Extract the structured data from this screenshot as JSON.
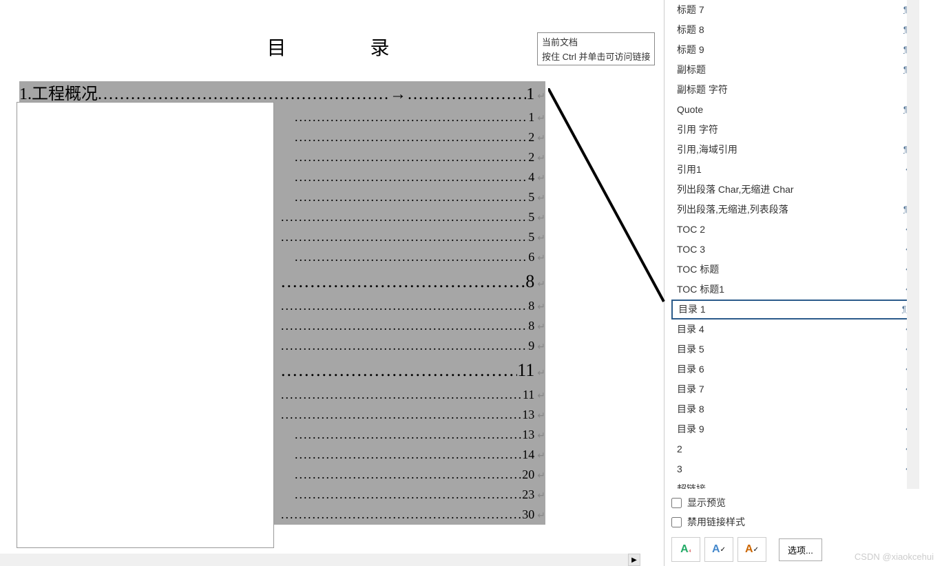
{
  "doc_title": "目　　　　录",
  "tooltip": {
    "line1": "当前文档",
    "line2": "按住 Ctrl 并单击可访问链接"
  },
  "toc": {
    "main": {
      "num": "1.",
      "title": "工程概况",
      "page": "1"
    },
    "rows": [
      {
        "page": "1",
        "sel": true,
        "cls": "indent2"
      },
      {
        "page": "2",
        "sel": true,
        "cls": "indent2"
      },
      {
        "page": "2",
        "sel": true,
        "cls": "indent2"
      },
      {
        "page": "4",
        "sel": true,
        "cls": "indent2"
      },
      {
        "page": "5",
        "sel": true,
        "cls": "indent2"
      },
      {
        "page": "5",
        "sel": true,
        "cls": "indent1"
      },
      {
        "page": "5",
        "sel": true,
        "cls": "indent1"
      },
      {
        "page": "6",
        "sel": true,
        "cls": "indent2"
      },
      {
        "page": "8",
        "sel": true,
        "cls": "indent1",
        "big": true
      },
      {
        "page": "8",
        "sel": true,
        "cls": "indent1"
      },
      {
        "page": "8",
        "sel": true,
        "cls": "indent1"
      },
      {
        "page": "9",
        "sel": true,
        "cls": "indent1"
      },
      {
        "page": "11",
        "sel": true,
        "cls": "indent1",
        "big": true
      },
      {
        "page": "11",
        "sel": true,
        "cls": "indent1"
      },
      {
        "page": "13",
        "sel": true,
        "cls": "indent1"
      },
      {
        "page": "13",
        "sel": true,
        "cls": "indent2"
      },
      {
        "page": "14",
        "sel": true,
        "cls": "indent2"
      },
      {
        "page": "20",
        "sel": true,
        "cls": "indent2"
      },
      {
        "page": "23",
        "sel": true,
        "cls": "indent2"
      },
      {
        "page": "30",
        "sel": true,
        "cls": "indent1"
      }
    ]
  },
  "styles": [
    {
      "name": "标题 7",
      "sym": "¶a",
      "type": "para"
    },
    {
      "name": "标题 8",
      "sym": "¶a",
      "type": "para"
    },
    {
      "name": "标题 9",
      "sym": "¶a",
      "type": "para"
    },
    {
      "name": "副标题",
      "sym": "¶a",
      "type": "para"
    },
    {
      "name": "副标题 字符",
      "sym": "a",
      "type": "char"
    },
    {
      "name": "Quote",
      "sym": "¶a",
      "type": "para"
    },
    {
      "name": "引用 字符",
      "sym": "a",
      "type": "char"
    },
    {
      "name": "引用,海域引用",
      "sym": "¶a",
      "type": "para"
    },
    {
      "name": "引用1",
      "sym": "↵",
      "type": "enter"
    },
    {
      "name": "列出段落 Char,无缩进 Char",
      "sym": "a",
      "type": "char"
    },
    {
      "name": "列出段落,无缩进,列表段落",
      "sym": "¶a",
      "type": "para"
    },
    {
      "name": "TOC 2",
      "sym": "↵",
      "type": "enter"
    },
    {
      "name": "TOC 3",
      "sym": "↵",
      "type": "enter"
    },
    {
      "name": "TOC 标题",
      "sym": "↵",
      "type": "enter"
    },
    {
      "name": "TOC 标题1",
      "sym": "↵",
      "type": "enter"
    },
    {
      "name": "目录 1",
      "sym": "¶a",
      "type": "para",
      "selected": true
    },
    {
      "name": "目录 4",
      "sym": "↵",
      "type": "enter"
    },
    {
      "name": "目录 5",
      "sym": "↵",
      "type": "enter"
    },
    {
      "name": "目录 6",
      "sym": "↵",
      "type": "enter"
    },
    {
      "name": "目录 7",
      "sym": "↵",
      "type": "enter"
    },
    {
      "name": "目录 8",
      "sym": "↵",
      "type": "enter"
    },
    {
      "name": "目录 9",
      "sym": "↵",
      "type": "enter"
    },
    {
      "name": "2",
      "sym": "↵",
      "type": "enter"
    },
    {
      "name": "3",
      "sym": "↵",
      "type": "enter"
    },
    {
      "name": "超链接",
      "sym": "a",
      "type": "char"
    }
  ],
  "footer": {
    "show_preview": "显示预览",
    "disable_linked": "禁用链接样式",
    "options": "选项..."
  },
  "watermark": "CSDN @xiaokcehui"
}
